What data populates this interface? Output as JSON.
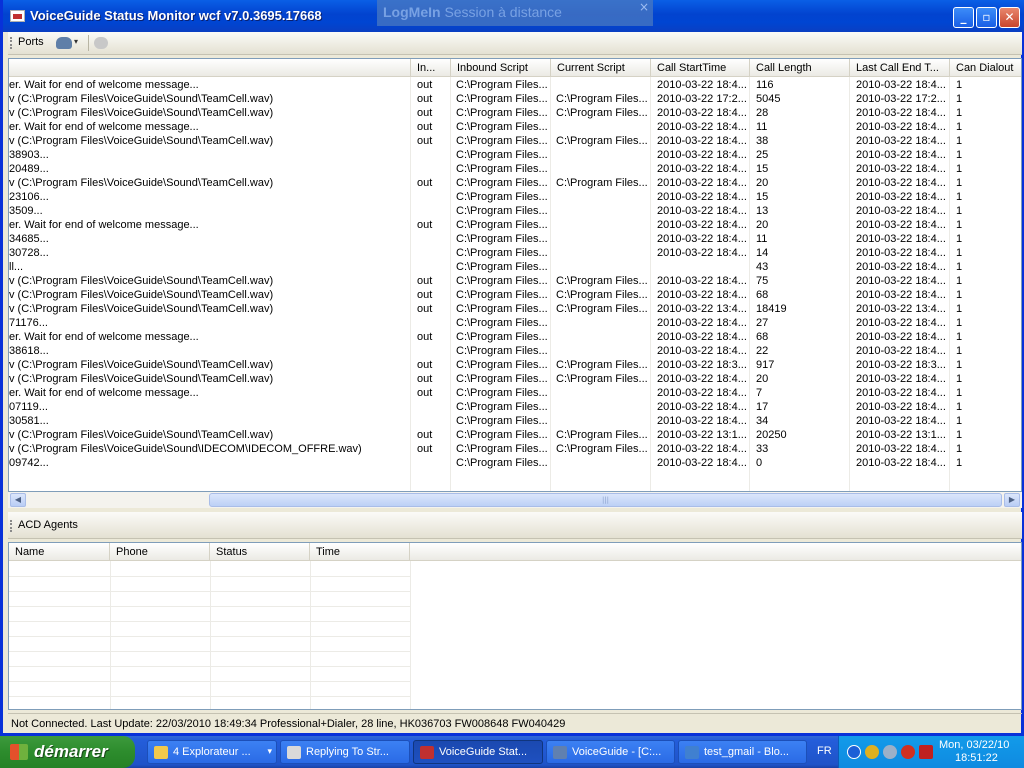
{
  "window": {
    "title": "VoiceGuide Status Monitor wcf v7.0.3695.17668",
    "controls": {
      "minimize": "_",
      "maximize": "▫",
      "close": "✕"
    }
  },
  "overlay": {
    "brand": "LogMeIn",
    "text": "Session à distance",
    "close": "×"
  },
  "toolbar": {
    "ports_label": "Ports",
    "dropdown_glyph": "▾"
  },
  "ports_grid": {
    "columns": [
      "",
      "In...",
      "Inbound Script",
      "Current Script",
      "Call StartTime",
      "Call Length",
      "Last Call End T...",
      "Can Dialout"
    ],
    "rows": [
      [
        "er. Wait for end of welcome message...",
        "out",
        "C:\\Program Files...",
        "",
        "2010-03-22 18:4...",
        "116",
        "2010-03-22 18:4...",
        "1"
      ],
      [
        "v (C:\\Program Files\\VoiceGuide\\Sound\\TeamCell.wav)",
        "out",
        "C:\\Program Files...",
        "C:\\Program Files...",
        "2010-03-22 17:2...",
        "5045",
        "2010-03-22 17:2...",
        "1"
      ],
      [
        "v (C:\\Program Files\\VoiceGuide\\Sound\\TeamCell.wav)",
        "out",
        "C:\\Program Files...",
        "C:\\Program Files...",
        "2010-03-22 18:4...",
        "28",
        "2010-03-22 18:4...",
        "1"
      ],
      [
        "er. Wait for end of welcome message...",
        "out",
        "C:\\Program Files...",
        "",
        "2010-03-22 18:4...",
        "11",
        "2010-03-22 18:4...",
        "1"
      ],
      [
        "v (C:\\Program Files\\VoiceGuide\\Sound\\TeamCell.wav)",
        "out",
        "C:\\Program Files...",
        "C:\\Program Files...",
        "2010-03-22 18:4...",
        "38",
        "2010-03-22 18:4...",
        "1"
      ],
      [
        "38903...",
        "",
        "C:\\Program Files...",
        "",
        "2010-03-22 18:4...",
        "25",
        "2010-03-22 18:4...",
        "1"
      ],
      [
        "20489...",
        "",
        "C:\\Program Files...",
        "",
        "2010-03-22 18:4...",
        "15",
        "2010-03-22 18:4...",
        "1"
      ],
      [
        "v (C:\\Program Files\\VoiceGuide\\Sound\\TeamCell.wav)",
        "out",
        "C:\\Program Files...",
        "C:\\Program Files...",
        "2010-03-22 18:4...",
        "20",
        "2010-03-22 18:4...",
        "1"
      ],
      [
        "23106...",
        "",
        "C:\\Program Files...",
        "",
        "2010-03-22 18:4...",
        "15",
        "2010-03-22 18:4...",
        "1"
      ],
      [
        "3509...",
        "",
        "C:\\Program Files...",
        "",
        "2010-03-22 18:4...",
        "13",
        "2010-03-22 18:4...",
        "1"
      ],
      [
        "er. Wait for end of welcome message...",
        "out",
        "C:\\Program Files...",
        "",
        "2010-03-22 18:4...",
        "20",
        "2010-03-22 18:4...",
        "1"
      ],
      [
        "34685...",
        "",
        "C:\\Program Files...",
        "",
        "2010-03-22 18:4...",
        "11",
        "2010-03-22 18:4...",
        "1"
      ],
      [
        "30728...",
        "",
        "C:\\Program Files...",
        "",
        "2010-03-22 18:4...",
        "14",
        "2010-03-22 18:4...",
        "1"
      ],
      [
        "ll...",
        "",
        "C:\\Program Files...",
        "",
        "",
        "43",
        "2010-03-22 18:4...",
        "1"
      ],
      [
        "v (C:\\Program Files\\VoiceGuide\\Sound\\TeamCell.wav)",
        "out",
        "C:\\Program Files...",
        "C:\\Program Files...",
        "2010-03-22 18:4...",
        "75",
        "2010-03-22 18:4...",
        "1"
      ],
      [
        "v (C:\\Program Files\\VoiceGuide\\Sound\\TeamCell.wav)",
        "out",
        "C:\\Program Files...",
        "C:\\Program Files...",
        "2010-03-22 18:4...",
        "68",
        "2010-03-22 18:4...",
        "1"
      ],
      [
        "v (C:\\Program Files\\VoiceGuide\\Sound\\TeamCell.wav)",
        "out",
        "C:\\Program Files...",
        "C:\\Program Files...",
        "2010-03-22 13:4...",
        "18419",
        "2010-03-22 13:4...",
        "1"
      ],
      [
        "71176...",
        "",
        "C:\\Program Files...",
        "",
        "2010-03-22 18:4...",
        "27",
        "2010-03-22 18:4...",
        "1"
      ],
      [
        "er. Wait for end of welcome message...",
        "out",
        "C:\\Program Files...",
        "",
        "2010-03-22 18:4...",
        "68",
        "2010-03-22 18:4...",
        "1"
      ],
      [
        "38618...",
        "",
        "C:\\Program Files...",
        "",
        "2010-03-22 18:4...",
        "22",
        "2010-03-22 18:4...",
        "1"
      ],
      [
        "v (C:\\Program Files\\VoiceGuide\\Sound\\TeamCell.wav)",
        "out",
        "C:\\Program Files...",
        "C:\\Program Files...",
        "2010-03-22 18:3...",
        "917",
        "2010-03-22 18:3...",
        "1"
      ],
      [
        "v (C:\\Program Files\\VoiceGuide\\Sound\\TeamCell.wav)",
        "out",
        "C:\\Program Files...",
        "C:\\Program Files...",
        "2010-03-22 18:4...",
        "20",
        "2010-03-22 18:4...",
        "1"
      ],
      [
        "er. Wait for end of welcome message...",
        "out",
        "C:\\Program Files...",
        "",
        "2010-03-22 18:4...",
        "7",
        "2010-03-22 18:4...",
        "1"
      ],
      [
        "07119...",
        "",
        "C:\\Program Files...",
        "",
        "2010-03-22 18:4...",
        "17",
        "2010-03-22 18:4...",
        "1"
      ],
      [
        "30581...",
        "",
        "C:\\Program Files...",
        "",
        "2010-03-22 18:4...",
        "34",
        "2010-03-22 18:4...",
        "1"
      ],
      [
        "v (C:\\Program Files\\VoiceGuide\\Sound\\TeamCell.wav)",
        "out",
        "C:\\Program Files...",
        "C:\\Program Files...",
        "2010-03-22 13:1...",
        "20250",
        "2010-03-22 13:1...",
        "1"
      ],
      [
        "v (C:\\Program Files\\VoiceGuide\\Sound\\IDECOM\\IDECOM_OFFRE.wav)",
        "out",
        "C:\\Program Files...",
        "C:\\Program Files...",
        "2010-03-22 18:4...",
        "33",
        "2010-03-22 18:4...",
        "1"
      ],
      [
        "09742...",
        "",
        "C:\\Program Files...",
        "",
        "2010-03-22 18:4...",
        "0",
        "2010-03-22 18:4...",
        "1"
      ]
    ]
  },
  "scrollbar": {
    "left_arrow": "◀",
    "right_arrow": "▶",
    "grip": "|||"
  },
  "acd": {
    "title": "ACD Agents",
    "columns": [
      "Name",
      "Phone",
      "Status",
      "Time"
    ]
  },
  "status_bar": {
    "text": "Not Connected. Last Update: 22/03/2010 18:49:34  Professional+Dialer, 28 line,  HK036703  FW008648  FW040429"
  },
  "taskbar": {
    "start_label": "démarrer",
    "tasks": [
      {
        "label": "4 Explorateur ...",
        "icon_color": "#f2c94c",
        "dropdown": "▾"
      },
      {
        "label": "Replying To Str...",
        "icon_color": "#d9d9d9"
      },
      {
        "label": "VoiceGuide Stat...",
        "icon_color": "#c03030"
      },
      {
        "label": "VoiceGuide - [C:...",
        "icon_color": "#6080b0"
      },
      {
        "label": "test_gmail - Blo...",
        "icon_color": "#4080d0"
      }
    ],
    "language": "FR",
    "clock_date": "Mon, 03/22/10",
    "clock_time": "18:51:22"
  },
  "colors": {
    "title_blue": "#0a5fe6",
    "start_green": "#3c9a3c",
    "grid_border": "#7f9db9"
  }
}
